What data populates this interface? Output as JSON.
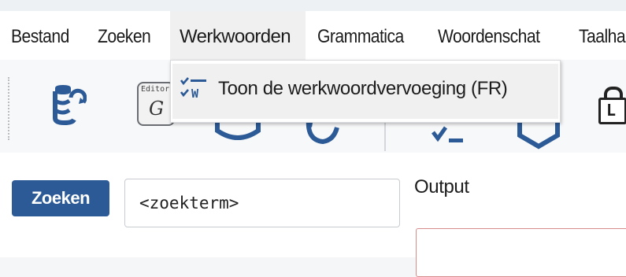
{
  "menubar": {
    "items": [
      {
        "label": "Bestand"
      },
      {
        "label": "Zoeken"
      },
      {
        "label": "Werkwoorden"
      },
      {
        "label": "Grammatica"
      },
      {
        "label": "Woordenschat"
      },
      {
        "label": "Taalha"
      }
    ]
  },
  "dropdown": {
    "items": [
      {
        "label": "Toon de werkwoordvervoeging (FR)",
        "icon": "conjugation-checklist-icon"
      }
    ]
  },
  "toolbar": {
    "icons": [
      "database-sync-icon",
      "editor-g-icon",
      "toolbar-tool-icon",
      "refresh-icon",
      "checklist-icon",
      "shield-icon",
      "lock-l-icon"
    ],
    "editor_icon_text": "Editor",
    "editor_icon_letter": "G",
    "lock_icon_letter": "L",
    "dropdown_icon_letter": "W"
  },
  "search": {
    "button_label": "Zoeken",
    "input_value": "<zoekterm>",
    "output_label": "Output"
  },
  "colors": {
    "accent_blue": "#2c5a96",
    "output_border": "#d78b8b"
  }
}
